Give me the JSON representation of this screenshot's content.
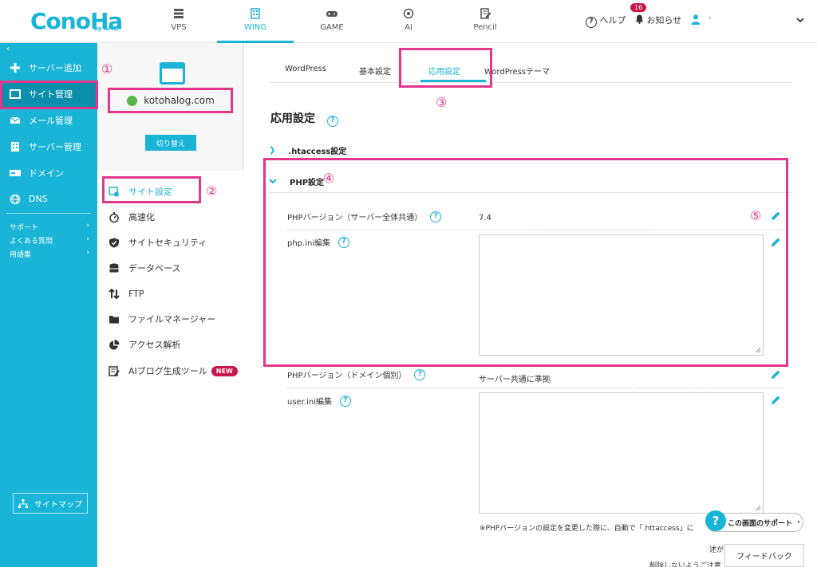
{
  "header": {
    "logo_text": "ConoHa",
    "logo_sub": "by GMO",
    "tabs": [
      {
        "label": "VPS",
        "icon": "server-icon"
      },
      {
        "label": "WING",
        "icon": "building-icon",
        "active": true
      },
      {
        "label": "GAME",
        "icon": "gamepad-icon"
      },
      {
        "label": "AI",
        "icon": "chip-icon"
      },
      {
        "label": "Pencil",
        "icon": "pencil-note-icon"
      }
    ],
    "help_label": "ヘルプ",
    "notifications_label": "お知らせ",
    "notifications_count": "16",
    "user_name": "·"
  },
  "sidebar": {
    "collapse": "‹",
    "items": [
      {
        "label": "サーバー追加",
        "icon": "plus-icon"
      },
      {
        "label": "サイト管理",
        "icon": "window-icon",
        "active": true
      },
      {
        "label": "メール管理",
        "icon": "mail-icon"
      },
      {
        "label": "サーバー管理",
        "icon": "building-icon"
      },
      {
        "label": "ドメイン",
        "icon": "domain-icon"
      },
      {
        "label": "DNS",
        "icon": "globe-icon"
      }
    ],
    "sub_items": [
      {
        "label": "サポート",
        "arrow": "›"
      },
      {
        "label": "よくある質問",
        "arrow": "›"
      },
      {
        "label": "用語集",
        "arrow": "›"
      }
    ],
    "sitemap_label": "サイトマップ"
  },
  "site_panel": {
    "domain": "kotohalog.com",
    "switch_label": "切り替え",
    "menu": [
      {
        "label": "サイト設定",
        "icon": "site-settings-icon",
        "active": true
      },
      {
        "label": "高速化",
        "icon": "stopwatch-icon"
      },
      {
        "label": "サイトセキュリティ",
        "icon": "shield-icon"
      },
      {
        "label": "データベース",
        "icon": "database-icon"
      },
      {
        "label": "FTP",
        "icon": "ftp-arrows-icon"
      },
      {
        "label": "ファイルマネージャー",
        "icon": "folder-icon"
      },
      {
        "label": "アクセス解析",
        "icon": "pie-chart-icon"
      },
      {
        "label": "AIブログ生成ツール",
        "icon": "ai-blog-icon",
        "badge": "NEW"
      }
    ]
  },
  "main": {
    "tabs": [
      {
        "label": "WordPress"
      },
      {
        "label": "基本設定"
      },
      {
        "label": "応用設定",
        "active": true
      },
      {
        "label": "WordPressテーマ"
      }
    ],
    "section_title": "応用設定",
    "help_glyph": "?",
    "htaccess_label": ".htaccess設定",
    "php_label": "PHP設定",
    "rows": {
      "php_version_label": "PHPバージョン（サーバー全体共通）",
      "php_version_value": "7.4",
      "php_ini_label": "php.ini編集",
      "php_version_domain_label": "PHPバージョン（ドメイン個別）",
      "php_version_domain_value": "サーバー共通に準拠",
      "user_ini_label": "user.ini編集"
    },
    "note": "※PHPバージョンの設定を変更した際に、自動で「.httaccess」に",
    "note_bottom": "述が",
    "note_bottom2": "削除しないようご注意",
    "support_label": "この画面のサポート",
    "support_arrow": "›",
    "feedback_label": "フィードバック"
  },
  "annotations": [
    "①",
    "②",
    "③",
    "④",
    "⑤"
  ],
  "colors": {
    "brand": "#19b4d6",
    "highlight": "#e3378c",
    "badge": "#c8174a",
    "power": "#57b546"
  }
}
